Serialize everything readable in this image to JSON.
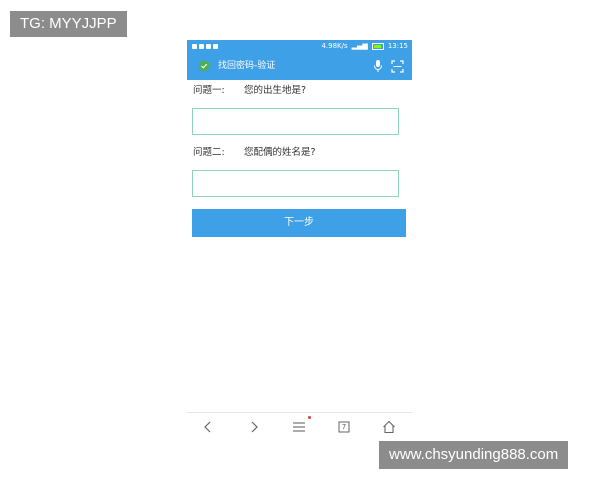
{
  "watermarks": {
    "top": "TG: MYYJJPP",
    "bottom": "www.chsyunding888.com"
  },
  "status_bar": {
    "network_speed": "4.98K/s",
    "time": "13:15"
  },
  "url_bar": {
    "title": "找回密码-验证",
    "icons": [
      "shield-icon",
      "microphone-icon",
      "scan-icon"
    ]
  },
  "form": {
    "question1_label": "问题一:",
    "question1_text": "您的出生地是?",
    "question1_answer": "",
    "question2_label": "问题二:",
    "question2_text": "您配偶的姓名是?",
    "question2_answer": "",
    "next_button": "下一步"
  },
  "nav_bar": {
    "tabs_count": "7",
    "icons": [
      "back-icon",
      "forward-icon",
      "menu-icon",
      "tabs-icon",
      "home-icon"
    ]
  },
  "colors": {
    "accent": "#3ea0e6",
    "input_border": "#8fd3bf"
  }
}
